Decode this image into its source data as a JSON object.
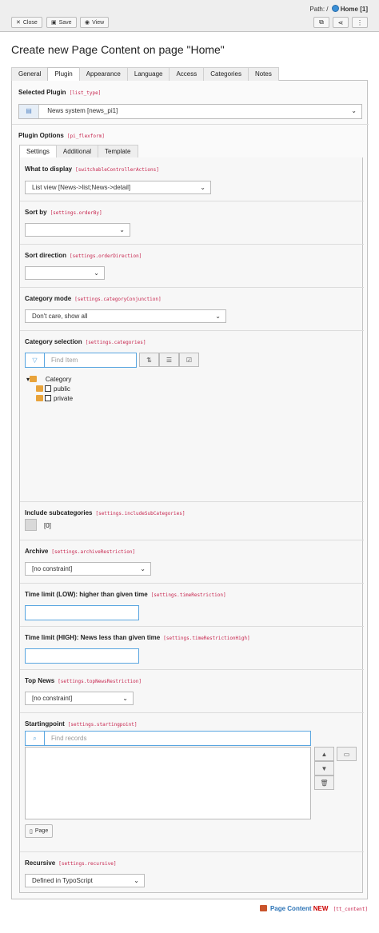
{
  "toolbar": {
    "close": "Close",
    "save": "Save",
    "view": "View"
  },
  "path": {
    "prefix": "Path: /",
    "page": "Home [1]"
  },
  "title": "Create new Page Content on page \"Home\"",
  "tabs": [
    "General",
    "Plugin",
    "Appearance",
    "Language",
    "Access",
    "Categories",
    "Notes"
  ],
  "plugin": {
    "label": "Selected Plugin",
    "code": "[list_type]",
    "value": "News system [news_pi1]"
  },
  "options": {
    "label": "Plugin Options",
    "code": "[pi_flexform]"
  },
  "subtabs": [
    "Settings",
    "Additional",
    "Template"
  ],
  "fields": {
    "display": {
      "label": "What to display",
      "code": "[switchableControllerActions]",
      "value": "List view [News->list;News->detail]"
    },
    "sortby": {
      "label": "Sort by",
      "code": "[settings.orderBy]",
      "value": ""
    },
    "sortdir": {
      "label": "Sort direction",
      "code": "[settings.orderDirection]",
      "value": ""
    },
    "catmode": {
      "label": "Category mode",
      "code": "[settings.categoryConjunction]",
      "value": "Don't care, show all"
    },
    "catsel": {
      "label": "Category selection",
      "code": "[settings.categories]",
      "placeholder": "Find Item"
    },
    "subcat": {
      "label": "Include subcategories",
      "code": "[settings.includeSubCategories]",
      "value": "[0]"
    },
    "archive": {
      "label": "Archive",
      "code": "[settings.archiveRestriction]",
      "value": "[no constraint]"
    },
    "timelow": {
      "label": "Time limit (LOW): higher than given time",
      "code": "[settings.timeRestriction]"
    },
    "timehigh": {
      "label": "Time limit (HIGH): News less than given time",
      "code": "[settings.timeRestrictionHigh]"
    },
    "topnews": {
      "label": "Top News",
      "code": "[settings.topNewsRestriction]",
      "value": "[no constraint]"
    },
    "starting": {
      "label": "Startingpoint",
      "code": "[settings.startingpoint]",
      "placeholder": "Find records",
      "page_button": "Page"
    },
    "recursive": {
      "label": "Recursive",
      "code": "[settings.recursive]",
      "value": "Defined in TypoScript"
    }
  },
  "tree": {
    "root": "Category",
    "items": [
      "public",
      "private"
    ]
  },
  "footer": {
    "label": "Page Content",
    "status": "NEW",
    "code": "[tt_content]"
  }
}
